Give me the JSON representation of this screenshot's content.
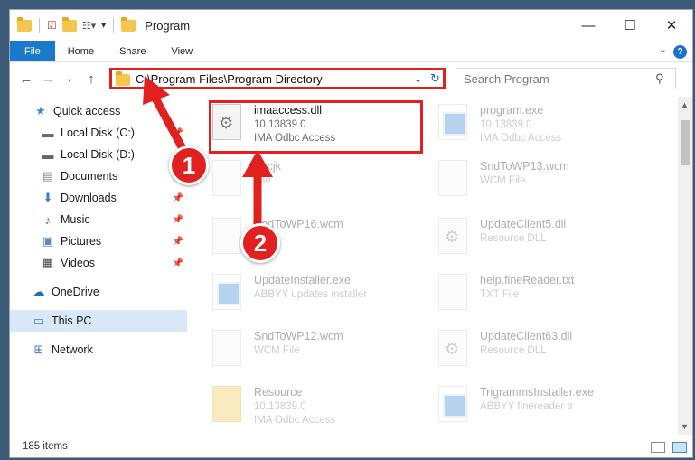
{
  "window": {
    "title": "Program"
  },
  "ribbon": {
    "tabs": [
      "File",
      "Home",
      "Share",
      "View"
    ]
  },
  "nav": {
    "address": "C:\\Program Files\\Program Directory",
    "search_placeholder": "Search Program"
  },
  "sidebar": {
    "items": [
      {
        "label": "Quick access",
        "icon": "star-icon"
      },
      {
        "label": "Local Disk (C:)",
        "icon": "drive-icon"
      },
      {
        "label": "Local Disk (D:)",
        "icon": "drive-icon"
      },
      {
        "label": "Documents",
        "icon": "documents-icon"
      },
      {
        "label": "Downloads",
        "icon": "downloads-icon"
      },
      {
        "label": "Music",
        "icon": "music-icon"
      },
      {
        "label": "Pictures",
        "icon": "pictures-icon"
      },
      {
        "label": "Videos",
        "icon": "videos-icon"
      },
      {
        "label": "OneDrive",
        "icon": "cloud-icon"
      },
      {
        "label": "This PC",
        "icon": "computer-icon"
      },
      {
        "label": "Network",
        "icon": "network-icon"
      }
    ]
  },
  "files": [
    {
      "name": "imaaccess.dll",
      "line1": "10.13839.0",
      "line2": "IMA Odbc Access"
    },
    {
      "name": "program.exe",
      "line1": "10.13839.0",
      "line2": "IMA Odbc Access"
    },
    {
      "name": "rd.cjk",
      "line1": "",
      "line2": "File"
    },
    {
      "name": "SndToWP13.wcm",
      "line1": "WCM File",
      "line2": ""
    },
    {
      "name": "SndToWP16.wcm",
      "line1": "",
      "line2": "File"
    },
    {
      "name": "UpdateClient5.dll",
      "line1": "Resource DLL",
      "line2": ""
    },
    {
      "name": "UpdateInstaller.exe",
      "line1": "ABBYY updates installer",
      "line2": ""
    },
    {
      "name": "help.fineReader.txt",
      "line1": "TXT File",
      "line2": ""
    },
    {
      "name": "SndToWP12.wcm",
      "line1": "WCM File",
      "line2": ""
    },
    {
      "name": "UpdateClient63.dll",
      "line1": "Resource DLL",
      "line2": ""
    },
    {
      "name": "Resource",
      "line1": "10.13839.0",
      "line2": "IMA Odbc Access"
    },
    {
      "name": "TrigrammsInstaller.exe",
      "line1": "ABBYY finereader tr",
      "line2": ""
    }
  ],
  "status": {
    "items_count": "185 items"
  },
  "callouts": [
    "1",
    "2"
  ],
  "colors": {
    "accent": "#1979ca",
    "highlight": "#e0211f"
  }
}
